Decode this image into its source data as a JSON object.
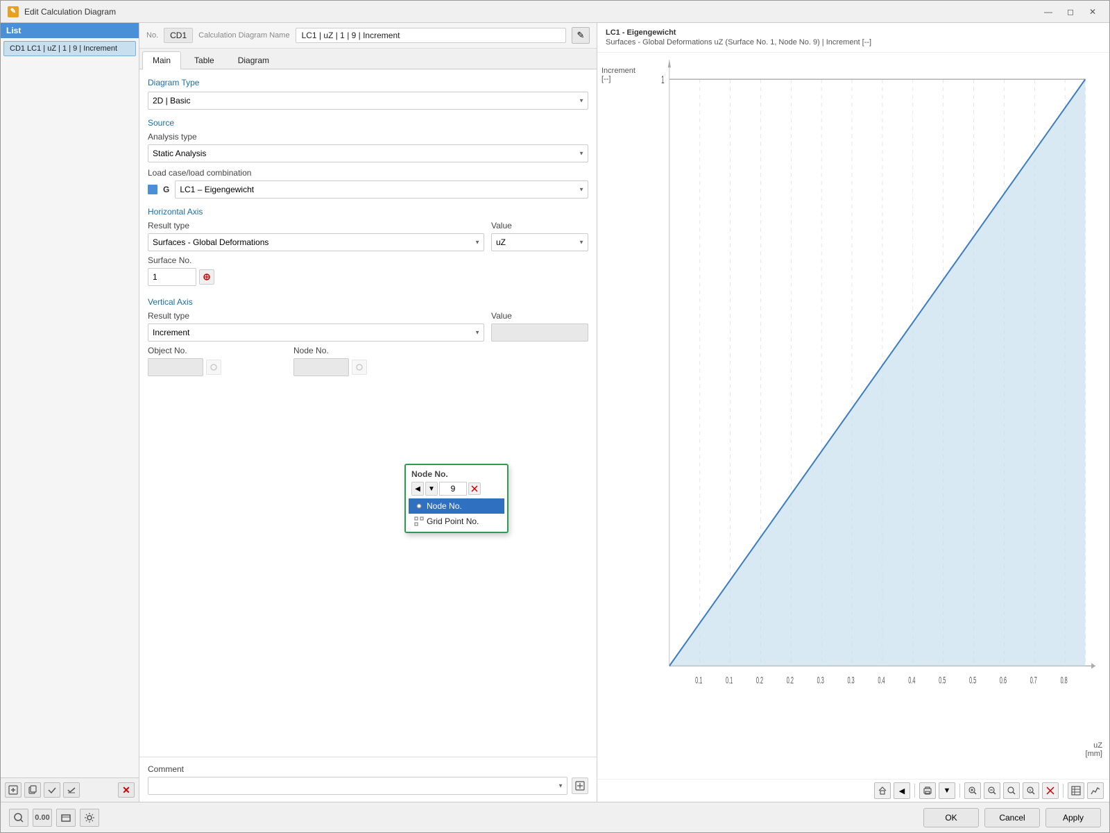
{
  "window": {
    "title": "Edit Calculation Diagram",
    "icon": "edit-icon"
  },
  "list": {
    "header": "List",
    "items": [
      {
        "label": "CD1  LC1 | uZ | 1 | 9 | Increment"
      }
    ]
  },
  "info_bar": {
    "no_label": "No.",
    "no_value": "CD1",
    "name_label": "Calculation Diagram Name",
    "name_value": "LC1 | uZ | 1 | 9 | Increment"
  },
  "tabs": [
    {
      "label": "Main",
      "active": true
    },
    {
      "label": "Table",
      "active": false
    },
    {
      "label": "Diagram",
      "active": false
    }
  ],
  "form": {
    "diagram_type_label": "Diagram Type",
    "diagram_type_value": "2D | Basic",
    "source_label": "Source",
    "analysis_type_label": "Analysis type",
    "analysis_type_value": "Static Analysis",
    "load_case_label": "Load case/load combination",
    "load_case_value": "LC1 – Eigengewicht",
    "horizontal_axis_label": "Horizontal Axis",
    "result_type_label": "Result type",
    "result_type_value": "Surfaces - Global Deformations",
    "value_label": "Value",
    "value_value": "uZ",
    "surface_no_label": "Surface No.",
    "surface_no_value": "1",
    "node_no_label": "Node No.",
    "node_no_value": "9",
    "vertical_axis_label": "Vertical Axis",
    "v_result_type_label": "Result type",
    "v_result_type_value": "Increment",
    "v_value_label": "Value",
    "v_value_value": "",
    "v_object_no_label": "Object No.",
    "v_object_no_value": "",
    "v_node_no_label": "Node No.",
    "v_node_no_value": "",
    "comment_label": "Comment",
    "comment_value": ""
  },
  "node_popup": {
    "title": "Node No.",
    "value": "9",
    "menu_items": [
      {
        "label": "Node No.",
        "selected": true,
        "icon": "node-icon"
      },
      {
        "label": "Grid Point No.",
        "selected": false,
        "icon": "grid-icon"
      }
    ]
  },
  "chart": {
    "title_line1": "LC1 - Eigengewicht",
    "title_line2": "Surfaces - Global Deformations uZ (Surface No. 1, Node No. 9) | Increment [--]",
    "y_axis_label": "Increment",
    "y_axis_unit": "[--]",
    "x_axis_label": "uZ",
    "x_axis_unit": "[mm]",
    "y_max": "1",
    "x_ticks": [
      "0.1",
      "0.1",
      "0.2",
      "0.2",
      "0.3",
      "0.3",
      "0.4",
      "0.4",
      "0.5",
      "0.5",
      "0.6",
      "0.6",
      "0.7",
      "0.7",
      "0.8"
    ],
    "x_max": "0.8"
  },
  "toolbar": {
    "ok_label": "OK",
    "cancel_label": "Cancel",
    "apply_label": "Apply"
  }
}
